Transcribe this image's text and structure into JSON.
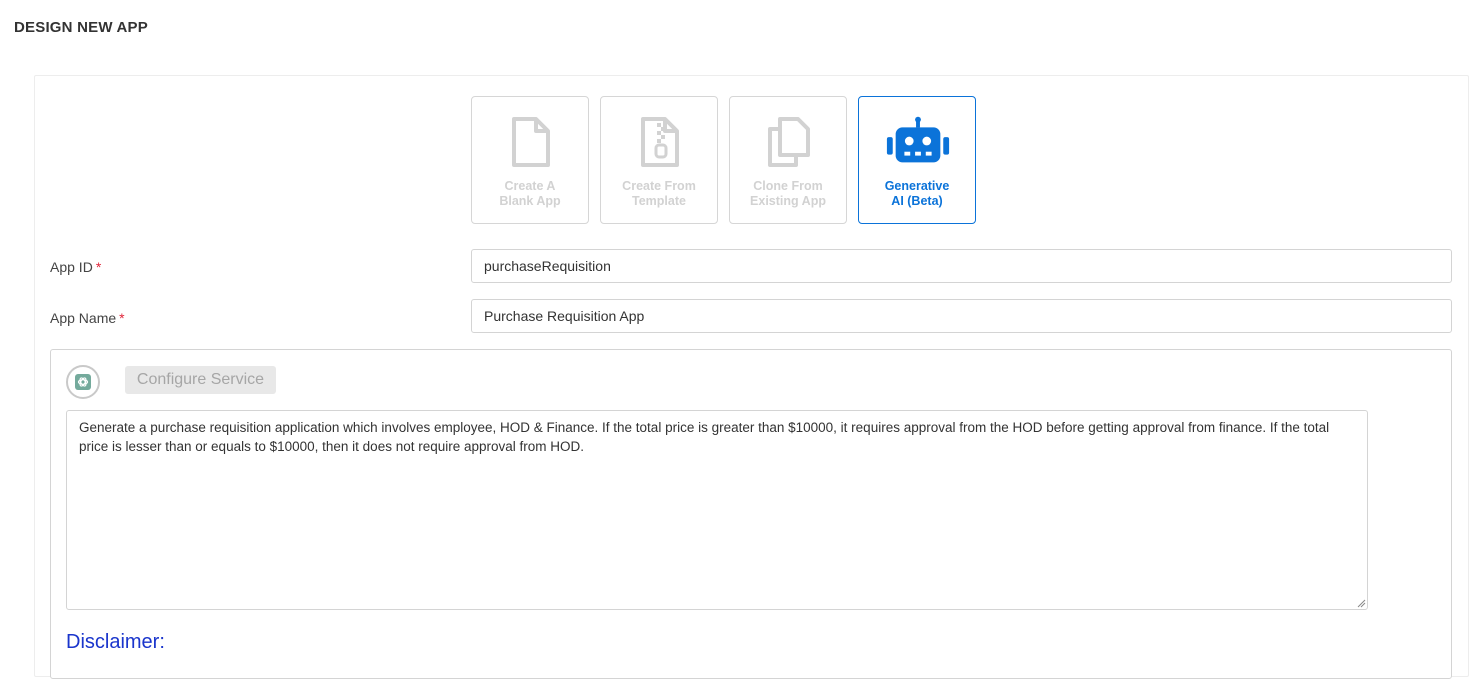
{
  "page": {
    "title": "DESIGN NEW APP"
  },
  "options": [
    {
      "label_line1": "Create A",
      "label_line2": "Blank App",
      "icon": "blank-file-icon",
      "active": false
    },
    {
      "label_line1": "Create From",
      "label_line2": "Template",
      "icon": "zip-file-icon",
      "active": false
    },
    {
      "label_line1": "Clone From",
      "label_line2": "Existing App",
      "icon": "copy-icon",
      "active": false
    },
    {
      "label_line1": "Generative",
      "label_line2": "AI (Beta)",
      "icon": "robot-icon",
      "active": true
    }
  ],
  "form": {
    "app_id": {
      "label": "App ID",
      "required_mark": "*",
      "value": "purchaseRequisition"
    },
    "app_name": {
      "label": "App Name",
      "required_mark": "*",
      "value": "Purchase Requisition App"
    }
  },
  "ai": {
    "avatar_icon": "openai-icon",
    "configure_label": "Configure Service",
    "prompt": "Generate a purchase requisition application which involves employee, HOD & Finance. If the total price is greater than $10000, it requires approval from the HOD before getting approval from finance. If the total price is lesser than or equals to $10000, then it does not require approval from HOD.",
    "disclaimer_title": "Disclaimer:"
  },
  "colors": {
    "accent": "#0b73d9",
    "disabled": "#d2d2d2",
    "required": "#e0253a",
    "disclaimer": "#1a35cc"
  }
}
